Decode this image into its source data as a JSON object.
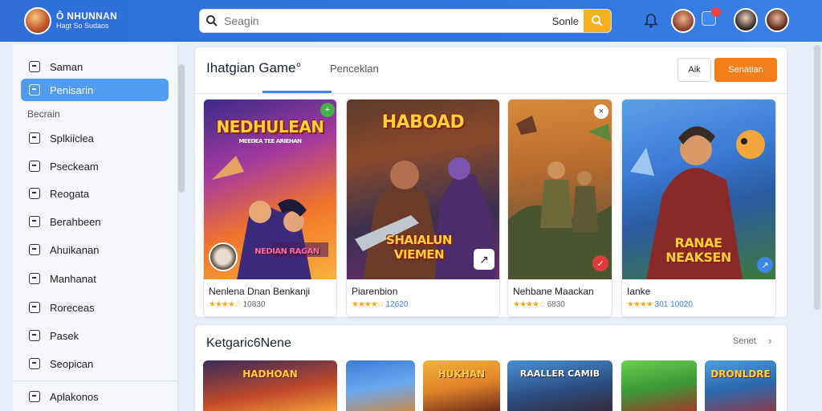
{
  "header": {
    "logo_line1": "Ô NHUNNAN",
    "logo_line2": "Hagt So Sudaos",
    "search_placeholder": "Seagin",
    "search_button_label": "Sonle"
  },
  "sidebar": {
    "items": [
      {
        "label": "Saman",
        "icon": "grid-icon",
        "active": false
      },
      {
        "label": "Penisarin",
        "icon": "controller-icon",
        "active": true
      }
    ],
    "heading": "Becrain",
    "section_items": [
      {
        "label": "Splkiiclea",
        "icon": "list-icon"
      },
      {
        "label": "Pseckeam",
        "icon": "folder-icon"
      },
      {
        "label": "Reogata",
        "icon": "chart-icon"
      },
      {
        "label": "Berahbeen",
        "icon": "window-icon"
      },
      {
        "label": "Ahuikanan",
        "icon": "pin-icon"
      },
      {
        "label": "Manhanat",
        "icon": "calendar-icon"
      },
      {
        "label": "Roreceas",
        "icon": "shield-icon"
      },
      {
        "label": "Pasek",
        "icon": "lock-icon"
      },
      {
        "label": "Seopican",
        "icon": "user-icon"
      }
    ],
    "footer_item": {
      "label": "Aplakonos",
      "icon": "settings-icon"
    }
  },
  "main": {
    "tab_active": "Ihatgian  Game°",
    "tab_other": "Penceklan",
    "btn_secondary": "Aik",
    "btn_primary": "Senatian",
    "cards": [
      {
        "art_title": "NEDHULEAN",
        "art_sub": "MEEDEA TEE ARIEHAN",
        "art_bottom": "NEDIAN RAGAN",
        "title": "Nenlena Dnan Benkanji",
        "stars": "★★★★☆",
        "rating": "10830",
        "accent": "#f25c2b"
      },
      {
        "art_title": "HABOAD",
        "art_sub": "",
        "art_bottom": "SHAIALUN VIEMEN",
        "title": "Piarenbion",
        "stars": "★★★★☆",
        "rating": "12620",
        "accent": "#c24a1a"
      },
      {
        "art_title": "",
        "art_sub": "",
        "art_bottom": "",
        "title": "Nehbane Maackan",
        "stars": "★★★★☆",
        "rating": "6830",
        "accent": "#9a6a33"
      },
      {
        "art_title": "",
        "art_sub": "",
        "art_bottom": "RANAE NEAKSEN",
        "title": "Ianke",
        "stars": "★★★★",
        "rating": "301 10020",
        "accent": "#3c7bd6"
      }
    ]
  },
  "section2": {
    "title": "Ketgaric6Nene",
    "link": "Senet",
    "thumbs": [
      {
        "label": "HADHOAN"
      },
      {
        "label": ""
      },
      {
        "label": "HUKHAN"
      },
      {
        "label": "RAALLER CAMIB"
      },
      {
        "label": ""
      },
      {
        "label": "DRONLDRE"
      }
    ]
  }
}
